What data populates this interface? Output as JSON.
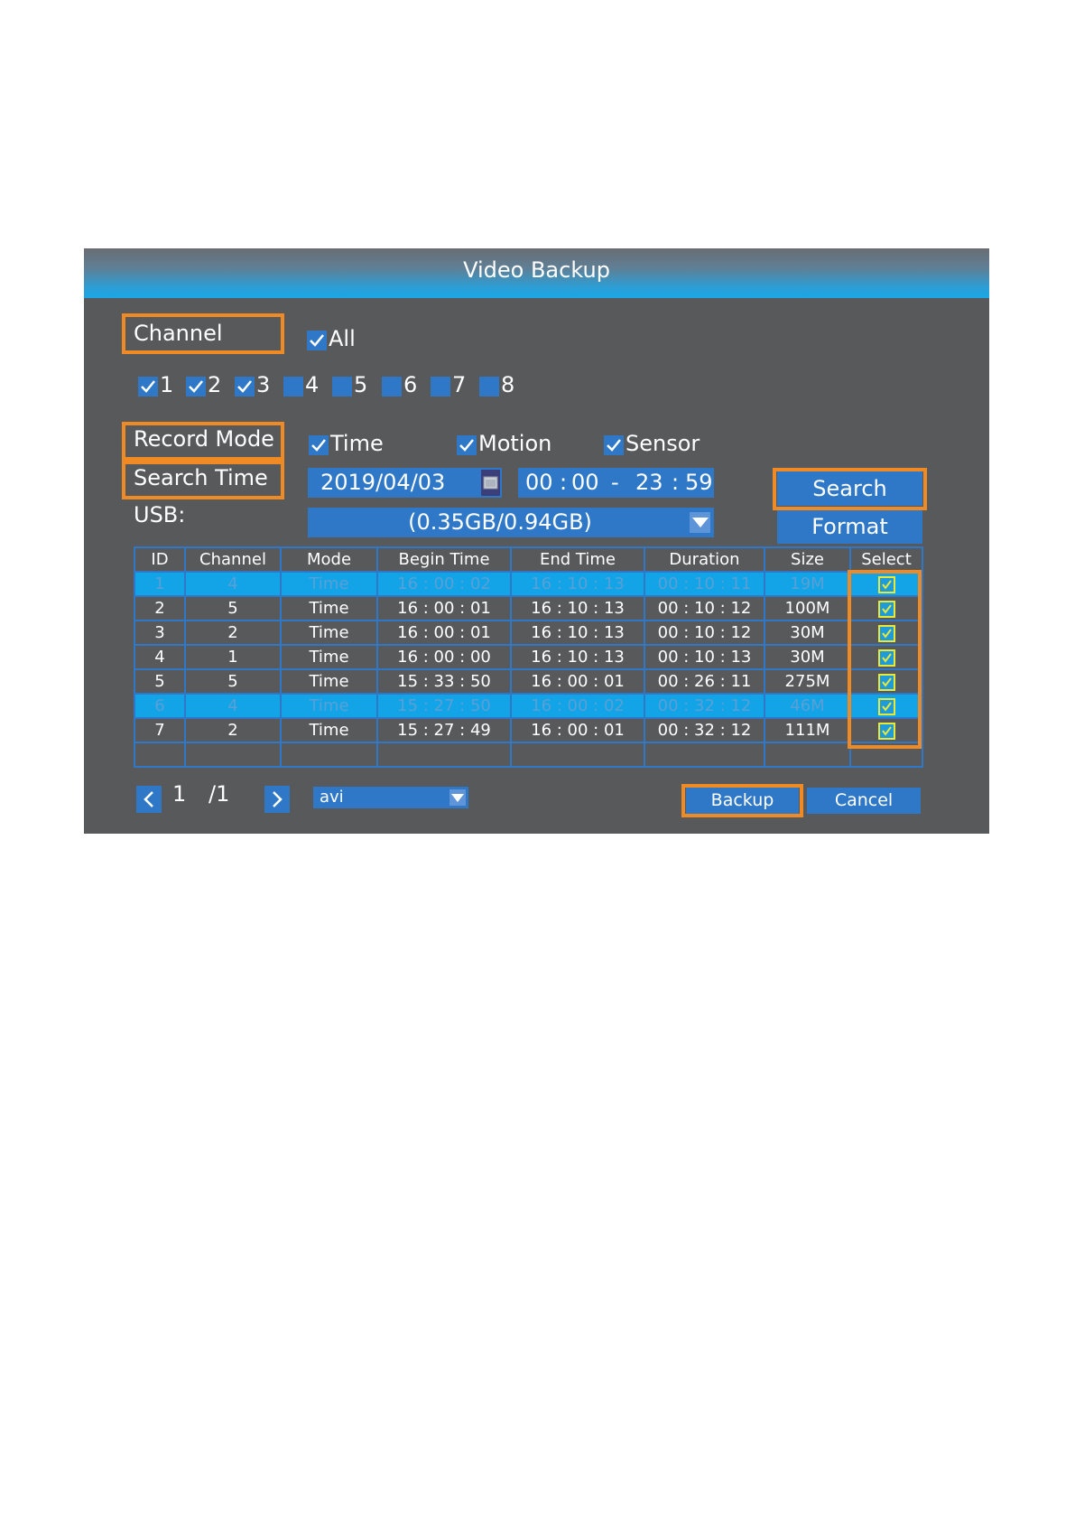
{
  "window": {
    "title": "Video Backup"
  },
  "channel": {
    "label": "Channel",
    "all_label": "All",
    "all_checked": true,
    "items": [
      {
        "label": "1",
        "checked": true
      },
      {
        "label": "2",
        "checked": true
      },
      {
        "label": "3",
        "checked": true
      },
      {
        "label": "4",
        "checked": false
      },
      {
        "label": "5",
        "checked": false
      },
      {
        "label": "6",
        "checked": false
      },
      {
        "label": "7",
        "checked": false
      },
      {
        "label": "8",
        "checked": false
      }
    ]
  },
  "record_mode": {
    "label": "Record Mode",
    "options": [
      {
        "label": "Time",
        "checked": true
      },
      {
        "label": "Motion",
        "checked": true
      },
      {
        "label": "Sensor",
        "checked": true
      }
    ]
  },
  "search_time": {
    "label": "Search Time",
    "date": "2019/04/03",
    "start_h": "00",
    "start_m": "00",
    "sep": "-",
    "end_h": "23",
    "end_m": "59"
  },
  "usb": {
    "label": "USB:",
    "value": "(0.35GB/0.94GB)"
  },
  "buttons": {
    "search": "Search",
    "format": "Format",
    "backup": "Backup",
    "cancel": "Cancel"
  },
  "table": {
    "headers": [
      "ID",
      "Channel",
      "Mode",
      "Begin Time",
      "End Time",
      "Duration",
      "Size",
      "Select"
    ],
    "rows": [
      {
        "id": "1",
        "channel": "4",
        "mode": "Time",
        "begin": "16 : 00 : 02",
        "end": "16 : 10 : 13",
        "duration": "00 : 10 : 11",
        "size": "19M",
        "selected": true,
        "highlight": true
      },
      {
        "id": "2",
        "channel": "5",
        "mode": "Time",
        "begin": "16 : 00 : 01",
        "end": "16 : 10 : 13",
        "duration": "00 : 10 : 12",
        "size": "100M",
        "selected": true,
        "highlight": false
      },
      {
        "id": "3",
        "channel": "2",
        "mode": "Time",
        "begin": "16 : 00 : 01",
        "end": "16 : 10 : 13",
        "duration": "00 : 10 : 12",
        "size": "30M",
        "selected": true,
        "highlight": false
      },
      {
        "id": "4",
        "channel": "1",
        "mode": "Time",
        "begin": "16 : 00 : 00",
        "end": "16 : 10 : 13",
        "duration": "00 : 10 : 13",
        "size": "30M",
        "selected": true,
        "highlight": false
      },
      {
        "id": "5",
        "channel": "5",
        "mode": "Time",
        "begin": "15 : 33 : 50",
        "end": "16 : 00 : 01",
        "duration": "00 : 26 : 11",
        "size": "275M",
        "selected": true,
        "highlight": false
      },
      {
        "id": "6",
        "channel": "4",
        "mode": "Time",
        "begin": "15 : 27 : 50",
        "end": "16 : 00 : 02",
        "duration": "00 : 32 : 12",
        "size": "46M",
        "selected": true,
        "highlight": true
      },
      {
        "id": "7",
        "channel": "2",
        "mode": "Time",
        "begin": "15 : 27 : 49",
        "end": "16 : 00 : 01",
        "duration": "00 : 32 : 12",
        "size": "111M",
        "selected": true,
        "highlight": false
      }
    ]
  },
  "pagination": {
    "current": "1",
    "total": "/1"
  },
  "format_select": {
    "value": "avi"
  },
  "colors": {
    "panel": "#58595b",
    "control": "#2f78c8",
    "highlight": "#12a4e6",
    "annotation": "#f08a24"
  },
  "icons": [
    "check-icon",
    "calendar-icon",
    "dropdown-arrow-icon",
    "chevron-left-icon",
    "chevron-right-icon"
  ]
}
